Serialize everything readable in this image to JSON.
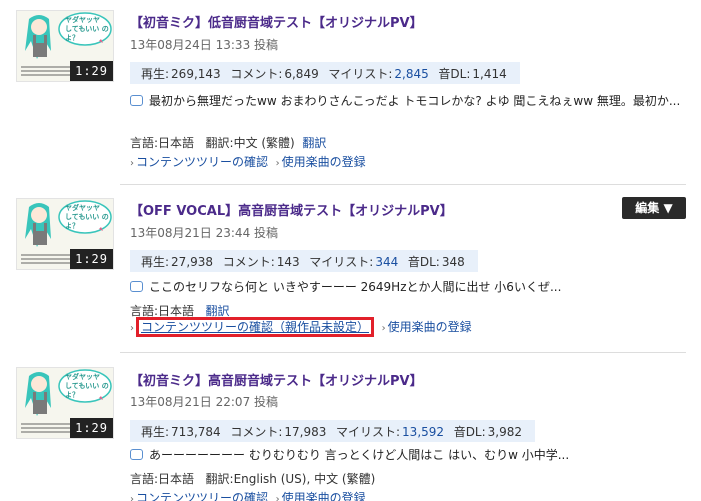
{
  "entries": [
    {
      "title": "【初音ミク】低音厨音域テスト【オリジナルPV】",
      "date": "13年08月24日 13:33 投稿",
      "duration": "1:29",
      "thumb_text": "ヤダヤッヤ してもいい のよ？",
      "stats": {
        "play_label": "再生:",
        "play": "269,143",
        "comment_label": "コメント:",
        "comments": "6,849",
        "mylist_label": "マイリスト:",
        "mylist": "2,845",
        "dl_label": "音DL:",
        "dl": "1,414"
      },
      "comment_text": "最初から無理だったww おまわりさんこっだよ トモコレかな? よゆ 聞こえねぇww 無理。最初か...",
      "lang_label": "言語:",
      "lang": "日本語",
      "trans_label": "翻訳:",
      "trans": "中文 (繁體)",
      "trans_link": "翻訳",
      "link1": "コンテンツツリーの確認",
      "link2": "使用楽曲の登録"
    },
    {
      "title": "【OFF VOCAL】高音厨音域テスト【オリジナルPV】",
      "date": "13年08月21日 23:44 投稿",
      "duration": "1:29",
      "thumb_text": "ヤダヤッヤ してもいい のよ？",
      "edit_label": "編集 ▼",
      "stats": {
        "play_label": "再生:",
        "play": "27,938",
        "comment_label": "コメント:",
        "comments": "143",
        "mylist_label": "マイリスト:",
        "mylist": "344",
        "dl_label": "音DL:",
        "dl": "348"
      },
      "comment_text": "ここのセリフなら何と いきやすーーー 2649Hzとか人間に出せ 小6いくぜ...",
      "lang_label": "言語:",
      "lang": "日本語",
      "trans_link": "翻訳",
      "link1": "コンテンツツリーの確認（親作品未設定）",
      "link2": "使用楽曲の登録"
    },
    {
      "title": "【初音ミク】高音厨音域テスト【オリジナルPV】",
      "date": "13年08月21日 22:07 投稿",
      "duration": "1:29",
      "thumb_text": "ヤダヤッヤ してもいい のよ？",
      "stats": {
        "play_label": "再生:",
        "play": "713,784",
        "comment_label": "コメント:",
        "comments": "17,983",
        "mylist_label": "マイリスト:",
        "mylist": "13,592",
        "dl_label": "音DL:",
        "dl": "3,982"
      },
      "comment_text": "あーーーーーーー むりむりむり 言っとくけど人間はこ はい、むりw 小中学...",
      "lang_label": "言語:",
      "lang": "日本語",
      "trans_label": "翻訳:",
      "trans": "English (US), 中文 (繁體)",
      "link1": "コンテンツツリーの確認",
      "link2": "使用楽曲の登録"
    }
  ],
  "colors": {
    "title": "#4b2a8a",
    "link": "#1a4fa0",
    "stats_bg": "#e8f0fa",
    "highlight": "#e2202a"
  }
}
